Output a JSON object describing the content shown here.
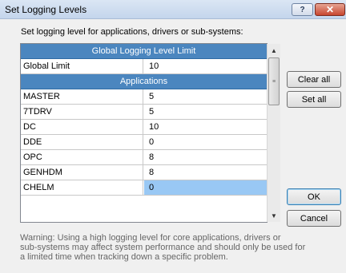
{
  "window": {
    "title": "Set Logging Levels",
    "help_label": "?",
    "close_label": "✕"
  },
  "instruction": "Set logging level for applications, drivers or sub-systems:",
  "grid": {
    "global_header": "Global Logging Level Limit",
    "global_row": {
      "name": "Global Limit",
      "value": "10"
    },
    "applications_header": "Applications",
    "rows": [
      {
        "name": "MASTER",
        "value": "5"
      },
      {
        "name": "7TDRV",
        "value": "5"
      },
      {
        "name": "DC",
        "value": "10"
      },
      {
        "name": "DDE",
        "value": "0"
      },
      {
        "name": "OPC",
        "value": "8"
      },
      {
        "name": "GENHDM",
        "value": "8"
      },
      {
        "name": "CHELM",
        "value": "0"
      }
    ]
  },
  "scrollbar": {
    "up_icon": "chevron-up-icon",
    "down_icon": "chevron-down-icon",
    "grip": "≡"
  },
  "buttons": {
    "clear_all": "Clear all",
    "set_all": "Set all",
    "ok": "OK",
    "cancel": "Cancel"
  },
  "warning": {
    "lines": [
      "Warning: Using a high logging level for core applications, drivers or",
      "sub-systems may affect system performance and should only be used for",
      "a limited time when tracking down a specific problem."
    ]
  }
}
